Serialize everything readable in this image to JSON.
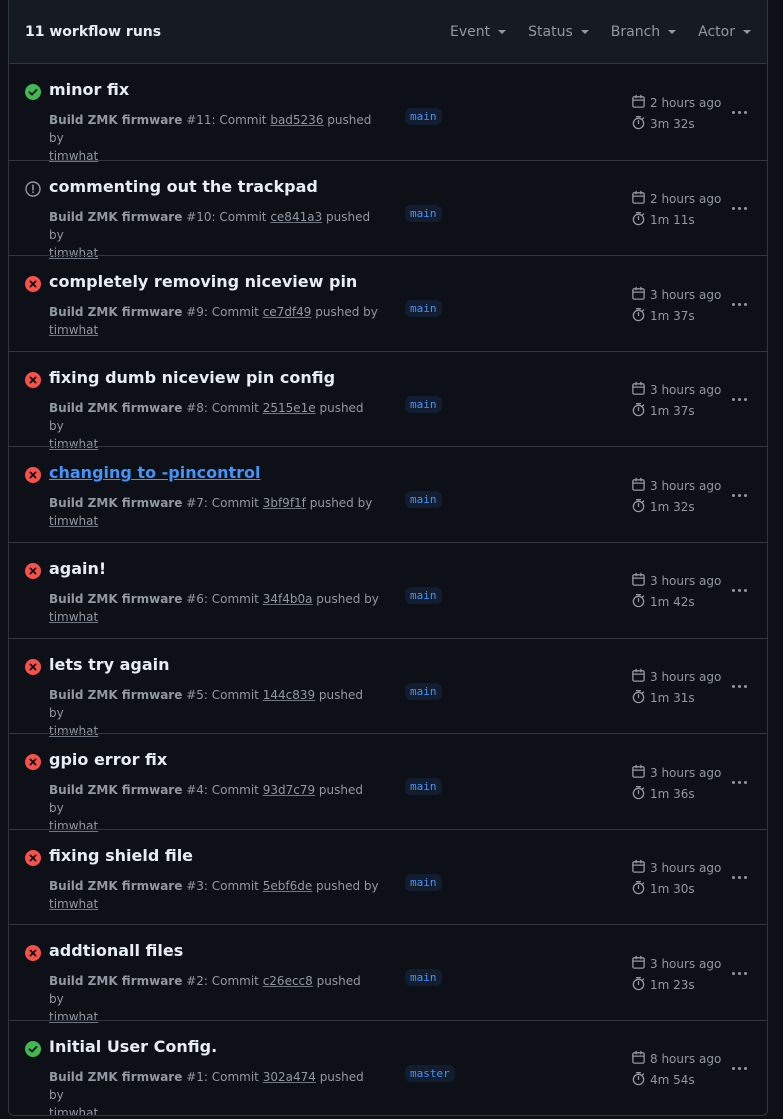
{
  "header": {
    "count_label": "11 workflow runs",
    "filters": [
      "Event",
      "Status",
      "Branch",
      "Actor"
    ]
  },
  "runs": [
    {
      "status": "success",
      "title": "minor fix",
      "workflow": "Build ZMK firmware",
      "run_number": "#11",
      "commit": "bad5236",
      "actor": "timwhat",
      "branch": "main",
      "time": "2 hours ago",
      "duration": "3m 32s",
      "link": false
    },
    {
      "status": "neutral",
      "title": "commenting out the trackpad",
      "workflow": "Build ZMK firmware",
      "run_number": "#10",
      "commit": "ce841a3",
      "actor": "timwhat",
      "branch": "main",
      "time": "2 hours ago",
      "duration": "1m 11s",
      "link": false
    },
    {
      "status": "failure",
      "title": "completely removing niceview pin",
      "workflow": "Build ZMK firmware",
      "run_number": "#9",
      "commit": "ce7df49",
      "actor": "timwhat",
      "branch": "main",
      "time": "3 hours ago",
      "duration": "1m 37s",
      "link": false
    },
    {
      "status": "failure",
      "title": "fixing dumb niceview pin config",
      "workflow": "Build ZMK firmware",
      "run_number": "#8",
      "commit": "2515e1e",
      "actor": "timwhat",
      "branch": "main",
      "time": "3 hours ago",
      "duration": "1m 37s",
      "link": false
    },
    {
      "status": "failure",
      "title": "changing to -pincontrol",
      "workflow": "Build ZMK firmware",
      "run_number": "#7",
      "commit": "3bf9f1f",
      "actor": "timwhat",
      "branch": "main",
      "time": "3 hours ago",
      "duration": "1m 32s",
      "link": true
    },
    {
      "status": "failure",
      "title": "again!",
      "workflow": "Build ZMK firmware",
      "run_number": "#6",
      "commit": "34f4b0a",
      "actor": "timwhat",
      "branch": "main",
      "time": "3 hours ago",
      "duration": "1m 42s",
      "link": false
    },
    {
      "status": "failure",
      "title": "lets try again",
      "workflow": "Build ZMK firmware",
      "run_number": "#5",
      "commit": "144c839",
      "actor": "timwhat",
      "branch": "main",
      "time": "3 hours ago",
      "duration": "1m 31s",
      "link": false
    },
    {
      "status": "failure",
      "title": "gpio error fix",
      "workflow": "Build ZMK firmware",
      "run_number": "#4",
      "commit": "93d7c79",
      "actor": "timwhat",
      "branch": "main",
      "time": "3 hours ago",
      "duration": "1m 36s",
      "link": false
    },
    {
      "status": "failure",
      "title": "fixing shield file",
      "workflow": "Build ZMK firmware",
      "run_number": "#3",
      "commit": "5ebf6de",
      "actor": "timwhat",
      "branch": "main",
      "time": "3 hours ago",
      "duration": "1m 30s",
      "link": false
    },
    {
      "status": "failure",
      "title": "addtionall files",
      "workflow": "Build ZMK firmware",
      "run_number": "#2",
      "commit": "c26ecc8",
      "actor": "timwhat",
      "branch": "main",
      "time": "3 hours ago",
      "duration": "1m 23s",
      "link": false
    },
    {
      "status": "success",
      "title": "Initial User Config.",
      "workflow": "Build ZMK firmware",
      "run_number": "#1",
      "commit": "302a474",
      "actor": "timwhat",
      "branch": "master",
      "time": "8 hours ago",
      "duration": "4m 54s",
      "link": false
    }
  ],
  "text": {
    "commit_word": ": Commit ",
    "pushed_by": " pushed by"
  },
  "colors": {
    "success": "#3fb950",
    "failure": "#f85149",
    "neutral": "#9198a1",
    "link": "#4493f8"
  }
}
